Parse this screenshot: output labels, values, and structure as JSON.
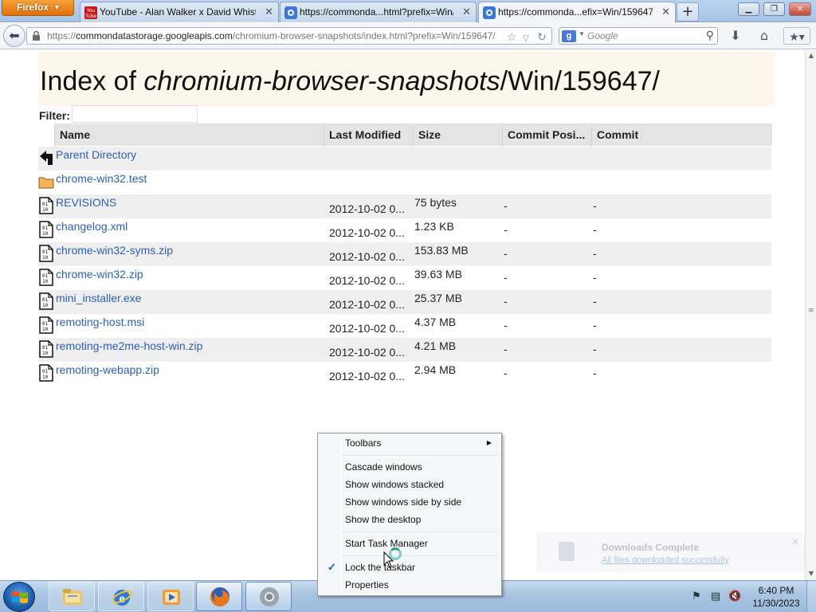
{
  "browser": {
    "menu_button": "Firefox",
    "tabs": [
      {
        "title": "YouTube - Alan Walker x David Whist...",
        "favicon": "youtube-icon",
        "active": false
      },
      {
        "title": "https://commonda...html?prefix=Win/",
        "favicon": "chrome-snapshot-icon",
        "active": false
      },
      {
        "title": "https://commonda...efix=Win/159647/",
        "favicon": "chrome-snapshot-icon",
        "active": true
      }
    ],
    "new_tab": "+",
    "url": {
      "scheme": "https://",
      "host": "commondatastorage.googleapis.com",
      "path": "/chromium-browser-snapshots/index.html?prefix=Win/159647/"
    },
    "search": {
      "engine": "g",
      "placeholder": "Google"
    }
  },
  "page": {
    "title_prefix": "Index of ",
    "title_italic": "chromium-browser-snapshots",
    "title_suffix": "/Win/159647/",
    "filter_label": "Filter:",
    "filter_value": "",
    "columns": [
      "Name",
      "Last Modified",
      "Size",
      "Commit Posi...",
      "Commit"
    ],
    "rows": [
      {
        "icon": "parent-directory-icon",
        "name": "Parent Directory",
        "modified": "",
        "size": "",
        "commit_position": "",
        "commit": ""
      },
      {
        "icon": "folder-icon",
        "name": "chrome-win32.test",
        "modified": "",
        "size": "",
        "commit_position": "",
        "commit": ""
      },
      {
        "icon": "binary-file-icon",
        "name": "REVISIONS",
        "modified": "2012-10-02 0...",
        "size": "75 bytes",
        "commit_position": "-",
        "commit": "-"
      },
      {
        "icon": "binary-file-icon",
        "name": "changelog.xml",
        "modified": "2012-10-02 0...",
        "size": "1.23 KB",
        "commit_position": "-",
        "commit": "-"
      },
      {
        "icon": "binary-file-icon",
        "name": "chrome-win32-syms.zip",
        "modified": "2012-10-02 0...",
        "size": "153.83 MB",
        "commit_position": "-",
        "commit": "-"
      },
      {
        "icon": "binary-file-icon",
        "name": "chrome-win32.zip",
        "modified": "2012-10-02 0...",
        "size": "39.63 MB",
        "commit_position": "-",
        "commit": "-"
      },
      {
        "icon": "binary-file-icon",
        "name": "mini_installer.exe",
        "modified": "2012-10-02 0...",
        "size": "25.37 MB",
        "commit_position": "-",
        "commit": "-"
      },
      {
        "icon": "binary-file-icon",
        "name": "remoting-host.msi",
        "modified": "2012-10-02 0...",
        "size": "4.37 MB",
        "commit_position": "-",
        "commit": "-"
      },
      {
        "icon": "binary-file-icon",
        "name": "remoting-me2me-host-win.zip",
        "modified": "2012-10-02 0...",
        "size": "4.21 MB",
        "commit_position": "-",
        "commit": "-"
      },
      {
        "icon": "binary-file-icon",
        "name": "remoting-webapp.zip",
        "modified": "2012-10-02 0...",
        "size": "2.94 MB",
        "commit_position": "-",
        "commit": "-"
      }
    ]
  },
  "download_toast": {
    "title": "Downloads Complete",
    "link": "All files downloaded successfully"
  },
  "context_menu": {
    "items": [
      {
        "label": "Toolbars",
        "submenu": true,
        "checked": false
      },
      {
        "label": "Cascade windows",
        "submenu": false,
        "checked": false
      },
      {
        "label": "Show windows stacked",
        "submenu": false,
        "checked": false
      },
      {
        "label": "Show windows side by side",
        "submenu": false,
        "checked": false
      },
      {
        "label": "Show the desktop",
        "submenu": false,
        "checked": false
      },
      {
        "label": "Start Task Manager",
        "submenu": false,
        "checked": false
      },
      {
        "label": "Lock the taskbar",
        "submenu": false,
        "checked": true
      },
      {
        "label": "Properties",
        "submenu": false,
        "checked": false
      }
    ]
  },
  "taskbar": {
    "apps": [
      {
        "icon": "windows-explorer-icon",
        "state": "pinned"
      },
      {
        "icon": "internet-explorer-icon",
        "state": "pinned"
      },
      {
        "icon": "media-player-icon",
        "state": "pinned"
      },
      {
        "icon": "firefox-icon",
        "state": "open"
      },
      {
        "icon": "chrome-icon",
        "state": "open"
      }
    ],
    "tray": [
      "action-center-flag-icon",
      "network-icon",
      "volume-muted-icon"
    ],
    "time": "6:40 PM",
    "date": "11/30/2023"
  },
  "colors": {
    "link": "#2b5fb8",
    "header_band": "#fdf6ea",
    "firefox_orange": "#e0700d"
  }
}
